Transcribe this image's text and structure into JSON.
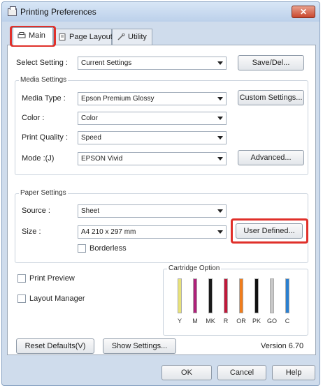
{
  "window": {
    "title": "Printing Preferences",
    "close_glyph": "✕"
  },
  "tabs": [
    {
      "label": "Main",
      "icon": "printer-icon"
    },
    {
      "label": "Page Layout",
      "icon": "page-icon"
    },
    {
      "label": "Utility",
      "icon": "wrench-icon"
    }
  ],
  "select_setting": {
    "label": "Select Setting :",
    "value": "Current Settings",
    "button": "Save/Del..."
  },
  "media": {
    "legend": "Media Settings",
    "media_type_label": "Media Type :",
    "media_type_value": "Epson Premium Glossy",
    "custom_button": "Custom Settings...",
    "color_label": "Color :",
    "color_value": "Color",
    "quality_label": "Print Quality :",
    "quality_value": "Speed",
    "mode_label": "Mode :(J)",
    "mode_value": "EPSON Vivid",
    "advanced_button": "Advanced..."
  },
  "paper": {
    "legend": "Paper Settings",
    "source_label": "Source :",
    "source_value": "Sheet",
    "size_label": "Size :",
    "size_value": "A4 210 x 297 mm",
    "user_defined_button": "User Defined...",
    "borderless_label": "Borderless"
  },
  "options": {
    "print_preview_label": "Print Preview",
    "layout_manager_label": "Layout Manager"
  },
  "cartridge": {
    "legend": "Cartridge Option",
    "inks": [
      {
        "code": "Y",
        "color": "#e8e27a"
      },
      {
        "code": "M",
        "color": "#b0207a"
      },
      {
        "code": "MK",
        "color": "#1a1a1a"
      },
      {
        "code": "R",
        "color": "#c0183a"
      },
      {
        "code": "OR",
        "color": "#f07d1c"
      },
      {
        "code": "PK",
        "color": "#111111"
      },
      {
        "code": "GO",
        "color": "#c8c8c8"
      },
      {
        "code": "C",
        "color": "#2a7fd0"
      }
    ]
  },
  "footer": {
    "reset_button": "Reset Defaults(V)",
    "show_button": "Show Settings...",
    "version": "Version 6.70"
  },
  "dialog_buttons": {
    "ok": "OK",
    "cancel": "Cancel",
    "help": "Help"
  },
  "colors": {
    "highlight": "#e0302a",
    "window_frame": "#cfdcec"
  }
}
